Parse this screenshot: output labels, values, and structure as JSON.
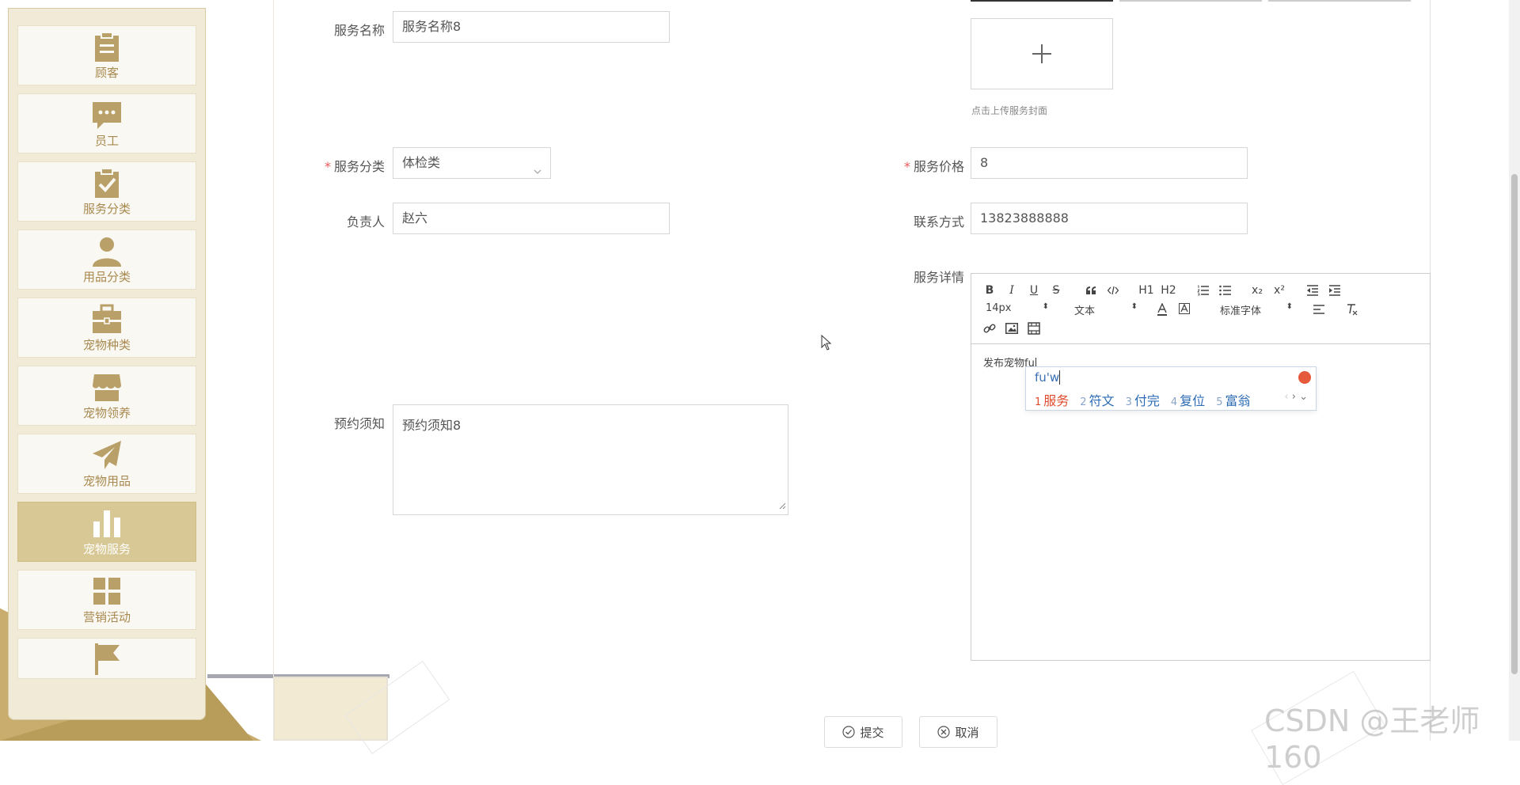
{
  "sidebar": {
    "items": [
      {
        "label": "顾客",
        "icon": "clipboard-icon",
        "active": false
      },
      {
        "label": "员工",
        "icon": "chat-bubble-icon",
        "active": false
      },
      {
        "label": "服务分类",
        "icon": "clipboard-check-icon",
        "active": false
      },
      {
        "label": "用品分类",
        "icon": "user-icon",
        "active": false
      },
      {
        "label": "宠物种类",
        "icon": "briefcase-icon",
        "active": false
      },
      {
        "label": "宠物领养",
        "icon": "shop-icon",
        "active": false
      },
      {
        "label": "宠物用品",
        "icon": "paper-plane-icon",
        "active": false
      },
      {
        "label": "宠物服务",
        "icon": "bar-chart-icon",
        "active": true
      },
      {
        "label": "营销活动",
        "icon": "grid-icon",
        "active": false
      },
      {
        "label": "",
        "icon": "flag-icon",
        "active": false
      }
    ]
  },
  "form": {
    "service_name": {
      "label": "服务名称",
      "value": "服务名称8"
    },
    "category": {
      "label": "服务分类",
      "value": "体检类",
      "required": true
    },
    "price": {
      "label": "服务价格",
      "value": "8",
      "required": true
    },
    "owner": {
      "label": "负责人",
      "value": "赵六"
    },
    "contact": {
      "label": "联系方式",
      "value": "13823888888"
    },
    "details": {
      "label": "服务详情"
    },
    "notice": {
      "label": "预约须知",
      "value": "预约须知8"
    },
    "cover": {
      "hint": "点击上传服务封面"
    }
  },
  "editor": {
    "font_size": "14px",
    "format": "文本",
    "font_family": "标准字体",
    "content": "发布宠物fu",
    "toolbar": {
      "bold": "B",
      "italic": "I",
      "underline": "U",
      "strike": "S",
      "h1": "H1",
      "h2": "H2",
      "sub": "x₂",
      "sup": "x²"
    }
  },
  "ime": {
    "input": "fu'w",
    "candidates": [
      {
        "num": "1",
        "text": "服务"
      },
      {
        "num": "2",
        "text": "符文"
      },
      {
        "num": "3",
        "text": "付完"
      },
      {
        "num": "4",
        "text": "复位"
      },
      {
        "num": "5",
        "text": "富翁"
      }
    ]
  },
  "actions": {
    "submit": "提交",
    "cancel": "取消"
  },
  "watermark": "CSDN @王老师160",
  "colors": {
    "sidebar_bg": "#f1ead7",
    "active_item": "#d8c895",
    "icon_gold": "#b8a068",
    "accent_gold": "#c9ad6e"
  }
}
